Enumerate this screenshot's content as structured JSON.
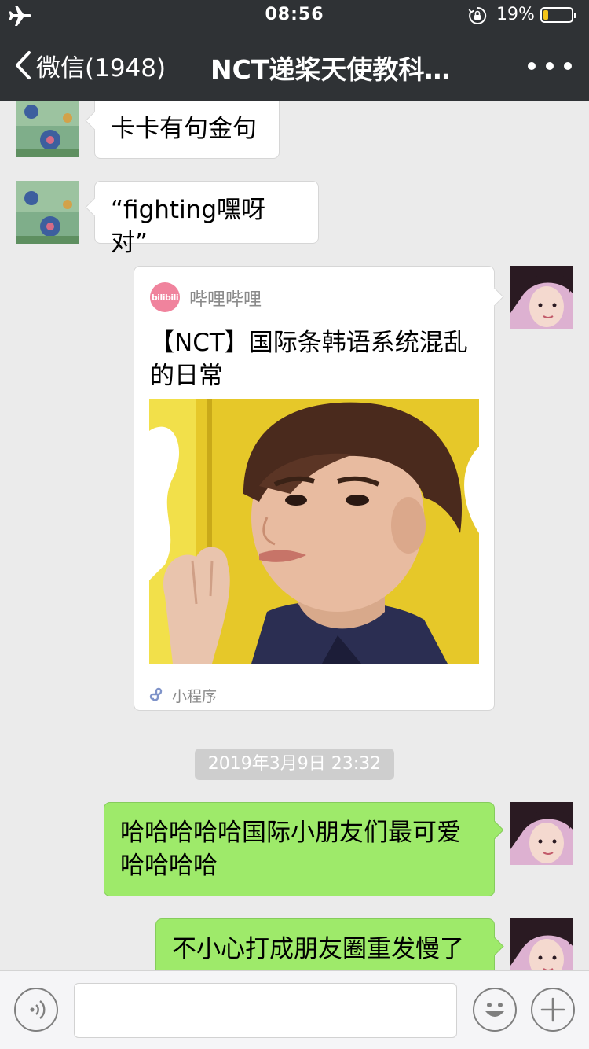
{
  "status_bar": {
    "time": "08:56",
    "battery_percent": "19%",
    "battery_level": 0.19,
    "icons": [
      "airplane-icon",
      "orientation-lock-icon",
      "battery-icon"
    ],
    "battery_color": "#f5c518"
  },
  "nav": {
    "back_label": "微信(1948)",
    "title": "NCT递桨天使教科…",
    "more_icon": "more-dots-icon"
  },
  "messages": [
    {
      "side": "left",
      "text": "卡卡有句金句"
    },
    {
      "side": "left",
      "text": "“fighting嘿呀对”"
    },
    {
      "side": "right",
      "type": "mini-program",
      "source_logo": "bilibili",
      "source_name": "哔哩哔哩",
      "title": "【NCT】国际条韩语系统混乱的日常",
      "footer_label": "小程序"
    },
    {
      "side": "timestamp",
      "text": "2019年3月9日 23:32"
    },
    {
      "side": "right",
      "text": "哈哈哈哈哈国际小朋友们最可爱哈哈哈哈"
    },
    {
      "side": "right",
      "text": "不小心打成朋友圈重发慢了"
    }
  ],
  "input_bar": {
    "voice_icon": "voice-icon",
    "input_value": "",
    "emoji_icon": "emoji-icon",
    "plus_icon": "plus-icon"
  },
  "colors": {
    "header_bg": "#2f3235",
    "chat_bg": "#ebebeb",
    "outgoing_bubble": "#9eea6a",
    "incoming_bubble": "#ffffff",
    "bilibili_pink": "#f0839d"
  }
}
